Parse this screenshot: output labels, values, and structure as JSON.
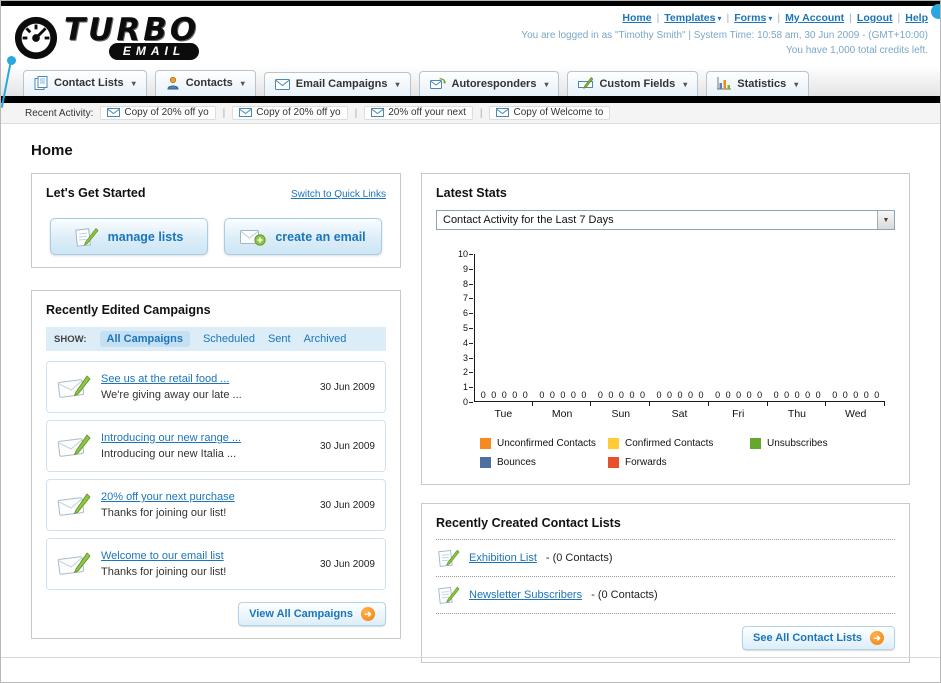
{
  "colors": {
    "link_blue": "#1b75bb",
    "accent_orange": "#f6891f",
    "nav_bar_black": "#000000",
    "filter_bar_blue": "#dcedf8",
    "callout_blue": "#2aa7e0"
  },
  "icons": {
    "speedometer-icon": "black gauge dial with needle",
    "chevron-down-icon": "▾",
    "envelope-icon": "✉",
    "envelope-pencil-icon": "envelope with green pencil",
    "pencil-paper-icon": "green pencil writing on paper",
    "envelope-plus-icon": "envelope with green plus badge",
    "arrow-right-icon": "➜ in orange circle",
    "dropdown-arrow-icon": "▼",
    "person-icon": "person silhouette",
    "list-icon": "stacked contact lists",
    "autoresponder-icon": "envelope with green refresh arrow",
    "field-pencil-icon": "input field with green pencil",
    "bar-chart-icon": "mini bar chart"
  },
  "header": {
    "logo": {
      "line1": "TURBO",
      "line2": "EMAIL"
    },
    "nav_links": [
      {
        "label": "Home",
        "dropdown": false
      },
      {
        "label": "Templates",
        "dropdown": true
      },
      {
        "label": "Forms",
        "dropdown": true
      },
      {
        "label": "My Account",
        "dropdown": false
      },
      {
        "label": "Logout",
        "dropdown": false
      },
      {
        "label": "Help",
        "dropdown": false
      }
    ],
    "session_line": "You are logged in as \"Timothy Smith\" | System Time: 10:58 am, 30 Jun 2009 - (GMT+10:00)",
    "credits_line": "You have 1,000 total credits left."
  },
  "nav_tabs": [
    {
      "label": "Contact Lists"
    },
    {
      "label": "Contacts"
    },
    {
      "label": "Email Campaigns"
    },
    {
      "label": "Autoresponders"
    },
    {
      "label": "Custom Fields"
    },
    {
      "label": "Statistics"
    }
  ],
  "recent_activity": {
    "label": "Recent Activity:",
    "items": [
      "Copy of 20% off yo",
      "Copy of 20% off yo",
      "20% off your next",
      "Copy of Welcome to"
    ]
  },
  "page_title": "Home",
  "get_started": {
    "title": "Let's Get Started",
    "switch_link": "Switch to Quick Links",
    "buttons": [
      {
        "label": "manage lists"
      },
      {
        "label": "create an email"
      }
    ]
  },
  "campaigns": {
    "title": "Recently Edited Campaigns",
    "show_label": "SHOW:",
    "filters": [
      "All Campaigns",
      "Scheduled",
      "Sent",
      "Archived"
    ],
    "items": [
      {
        "title": "See us at the retail food ...",
        "subtitle": "We're giving away our late ...",
        "date": "30 Jun 2009"
      },
      {
        "title": "Introducing our new range ...",
        "subtitle": "Introducing our new Italia ...",
        "date": "30 Jun 2009"
      },
      {
        "title": "20% off your next purchase",
        "subtitle": "Thanks for joining our list!",
        "date": "30 Jun 2009"
      },
      {
        "title": "Welcome to our email list",
        "subtitle": "Thanks for joining our list!",
        "date": "30 Jun 2009"
      }
    ],
    "view_all_label": "View All Campaigns"
  },
  "latest_stats": {
    "title": "Latest Stats",
    "dropdown_value": "Contact Activity for the Last 7 Days",
    "chart_data": {
      "type": "bar",
      "title": "Contact Activity for the Last 7 Days",
      "categories": [
        "Tue",
        "Mon",
        "Sun",
        "Sat",
        "Fri",
        "Thu",
        "Wed"
      ],
      "series": [
        {
          "name": "Unconfirmed Contacts",
          "color": "#f6891f",
          "values": [
            0,
            0,
            0,
            0,
            0,
            0,
            0
          ]
        },
        {
          "name": "Confirmed Contacts",
          "color": "#ffcc33",
          "values": [
            0,
            0,
            0,
            0,
            0,
            0,
            0
          ]
        },
        {
          "name": "Unsubscribes",
          "color": "#65a82d",
          "values": [
            0,
            0,
            0,
            0,
            0,
            0,
            0
          ]
        },
        {
          "name": "Bounces",
          "color": "#4f6fa0",
          "values": [
            0,
            0,
            0,
            0,
            0,
            0,
            0
          ]
        },
        {
          "name": "Forwards",
          "color": "#e8502b",
          "values": [
            0,
            0,
            0,
            0,
            0,
            0,
            0
          ]
        }
      ],
      "xlabel": "",
      "ylabel": "",
      "ylim": [
        0,
        10
      ],
      "grid": false,
      "legend_position": "bottom"
    }
  },
  "contact_lists": {
    "title": "Recently Created Contact Lists",
    "items": [
      {
        "name": "Exhibition List",
        "detail": "- (0 Contacts)"
      },
      {
        "name": "Newsletter Subscribers",
        "detail": "- (0 Contacts)"
      }
    ],
    "see_all_label": "See All Contact Lists"
  }
}
